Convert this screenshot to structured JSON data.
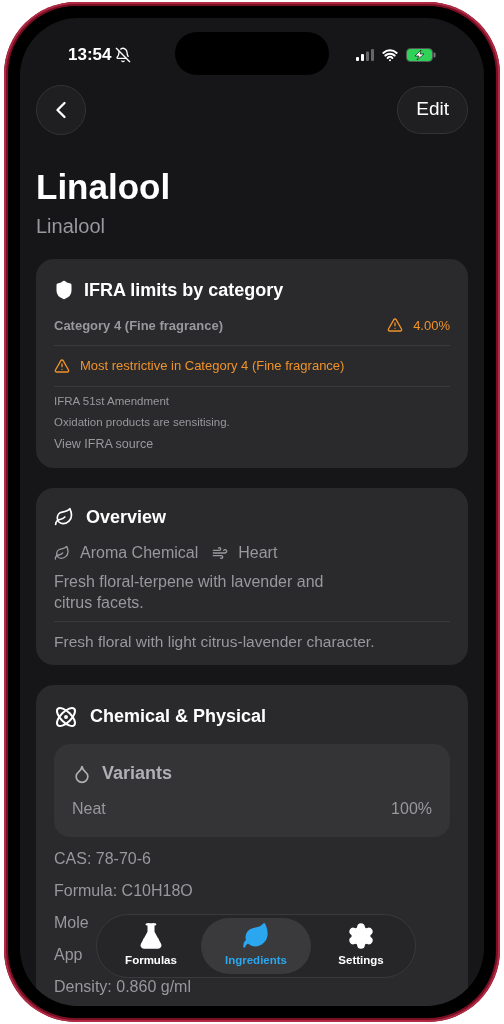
{
  "status_bar": {
    "time": "13:54",
    "silent": true
  },
  "nav": {
    "action": "Edit"
  },
  "header": {
    "title": "Linalool",
    "subtitle": "Linalool"
  },
  "ifra": {
    "title": "IFRA limits by category",
    "limits": [
      {
        "category": "Category 4 (Fine fragrance)",
        "value": "4.00%",
        "warning": true
      }
    ],
    "notice": "Most restrictive in Category 4 (Fine fragrance)",
    "notes": [
      "IFRA 51st Amendment",
      "Oxidation products are sensitising."
    ],
    "link": "View IFRA source"
  },
  "overview": {
    "title": "Overview",
    "tags": [
      {
        "kind": "type",
        "label": "Aroma Chemical"
      },
      {
        "kind": "note",
        "label": "Heart"
      }
    ],
    "description": "Fresh floral-terpene with lavender and citrus facets.",
    "summary": "Fresh floral with light citrus-lavender character."
  },
  "chemical": {
    "title": "Chemical & Physical",
    "variants": {
      "title": "Variants",
      "items": [
        {
          "name": "Neat",
          "share": "100%"
        }
      ]
    },
    "properties": [
      "CAS: 78-70-6",
      "Formula: C10H18O",
      "Mole",
      "App",
      "Density: 0.860 g/ml"
    ]
  },
  "tab_bar": [
    {
      "kind": "formulas",
      "label": "Formulas",
      "selected": false
    },
    {
      "kind": "ingredients",
      "label": "Ingredients",
      "selected": true
    },
    {
      "kind": "settings",
      "label": "Settings",
      "selected": false
    }
  ]
}
